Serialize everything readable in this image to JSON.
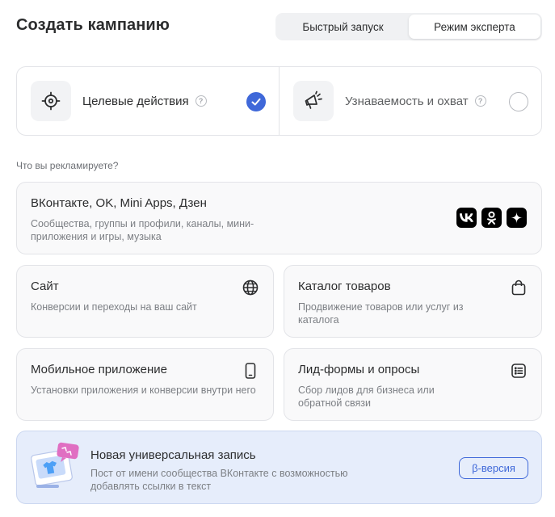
{
  "header": {
    "title": "Создать кампанию",
    "modes": [
      "Быстрый запуск",
      "Режим эксперта"
    ],
    "active_mode": "Режим эксперта"
  },
  "goals": [
    {
      "label": "Целевые действия",
      "icon": "target-icon",
      "help": "?",
      "selected": true
    },
    {
      "label": "Узнаваемость и охват",
      "icon": "megaphone-icon",
      "help": "?",
      "selected": false
    }
  ],
  "section_label": "Что вы рекламируете?",
  "cards": {
    "vk": {
      "title": "ВКонтакте, OK, Mini Apps, Дзен",
      "desc": "Сообщества, группы и профили, каналы, мини-приложения и игры, музыка",
      "icons": [
        "vk-icon",
        "ok-icon",
        "dzen-icon"
      ]
    },
    "site": {
      "title": "Сайт",
      "desc": "Конверсии и переходы на ваш сайт",
      "icon": "globe-icon"
    },
    "catalog": {
      "title": "Каталог товаров",
      "desc": "Продвижение товаров или услуг из каталога",
      "icon": "shopping-bag-icon"
    },
    "mobile": {
      "title": "Мобильное приложение",
      "desc": "Установки приложения и конверсии внутри него",
      "icon": "smartphone-icon"
    },
    "lead": {
      "title": "Лид-формы и опросы",
      "desc": "Сбор лидов для бизнеса или обратной связи",
      "icon": "list-form-icon"
    }
  },
  "promo": {
    "title": "Новая универсальная запись",
    "desc": "Пост от имени сообщества ВКонтакте с возможностью добавлять ссылки в текст",
    "button": "β-версия",
    "icon": "post-illustration-icon"
  },
  "colors": {
    "accent": "#3f68d9",
    "promo_bg": "#e6edfb",
    "card_bg": "#f9f9fa",
    "border": "#e3e4e8"
  }
}
